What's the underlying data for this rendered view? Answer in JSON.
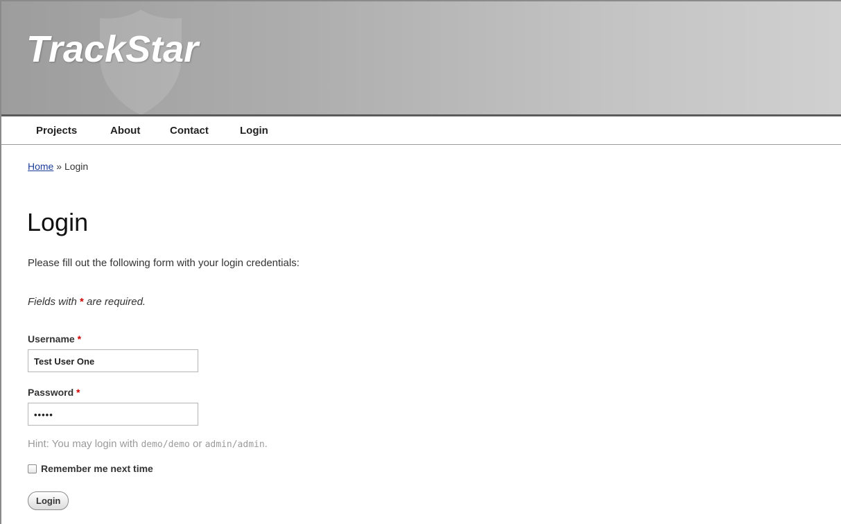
{
  "header": {
    "logo_text": "TrackStar"
  },
  "nav": {
    "items": [
      {
        "label": "Projects"
      },
      {
        "label": "About"
      },
      {
        "label": "Contact"
      },
      {
        "label": "Login"
      }
    ]
  },
  "breadcrumb": {
    "home": "Home",
    "separator": " » ",
    "current": "Login"
  },
  "page": {
    "title": "Login",
    "intro": "Please fill out the following form with your login credentials:",
    "note_before": "Fields with ",
    "note_star": "*",
    "note_after": " are required."
  },
  "form": {
    "username_label": "Username",
    "username_required": "*",
    "username_value": "Test User One",
    "password_label": "Password",
    "password_required": "*",
    "password_value": "•••••",
    "hint_prefix": "Hint: You may login with ",
    "hint_cred1": "demo/demo",
    "hint_or": " or ",
    "hint_cred2": "admin/admin",
    "hint_suffix": ".",
    "remember_label": "Remember me next time",
    "remember_checked": false,
    "submit_label": "Login"
  },
  "colors": {
    "required_star": "#cc0000",
    "link": "#1a3d99",
    "hint": "#9a9a9a"
  }
}
